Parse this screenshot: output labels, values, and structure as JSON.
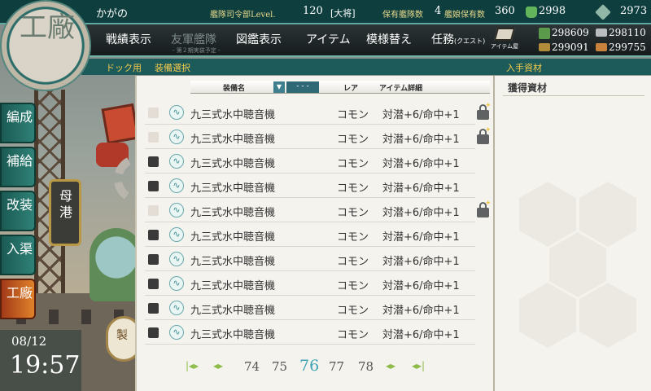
{
  "header": {
    "admiral_name": "かがの",
    "hq_level_label": "艦隊司令部Level.",
    "hq_level": "120",
    "rank": "[大将]",
    "fleet_count_label": "保有艦隊数",
    "fleet_count": "4",
    "ship_count_label": "艦娘保有数",
    "ship_count": "360",
    "bucket_count": "2998",
    "devmat_count": "2973"
  },
  "emblem_text": "工廠",
  "menu": {
    "items": [
      {
        "label": "戦績表示"
      },
      {
        "label": "友軍艦隊",
        "sub": "- 第２期実装予定 -",
        "disabled": true
      },
      {
        "label": "図鑑表示"
      },
      {
        "label": "アイテム"
      },
      {
        "label": "模様替え"
      },
      {
        "label": "任務",
        "small": "(クエスト)"
      }
    ],
    "shop_label": "アイテム屋"
  },
  "resources": {
    "fuel": "298609",
    "steel": "298110",
    "ammo": "299091",
    "bauxite": "299755"
  },
  "breadcrumb": {
    "dock": "ドック用",
    "title": "装備選択",
    "obtained": "入手資材"
  },
  "side_nav": [
    {
      "label": "編成",
      "icon": "fleet-icon"
    },
    {
      "label": "補給",
      "icon": "supply-icon"
    },
    {
      "label": "改装",
      "icon": "remodel-icon"
    },
    {
      "label": "入渠",
      "icon": "repair-icon"
    },
    {
      "label": "工廠",
      "icon": "arsenal-icon"
    }
  ],
  "mode_switch": "母港",
  "craft_button": "製",
  "clock": {
    "date": "08/12",
    "time": "19:57"
  },
  "list": {
    "col_name": "装備名",
    "sort_label": "- - -",
    "col_rarity": "レア",
    "col_detail": "アイテム詳細",
    "rows": [
      {
        "name": "九三式水中聴音機",
        "rarity": "コモン",
        "detail": "対潜+6/命中+1",
        "checked": false,
        "locked": true
      },
      {
        "name": "九三式水中聴音機",
        "rarity": "コモン",
        "detail": "対潜+6/命中+1",
        "checked": false,
        "locked": true
      },
      {
        "name": "九三式水中聴音機",
        "rarity": "コモン",
        "detail": "対潜+6/命中+1",
        "checked": true,
        "locked": false
      },
      {
        "name": "九三式水中聴音機",
        "rarity": "コモン",
        "detail": "対潜+6/命中+1",
        "checked": true,
        "locked": false
      },
      {
        "name": "九三式水中聴音機",
        "rarity": "コモン",
        "detail": "対潜+6/命中+1",
        "checked": false,
        "locked": true
      },
      {
        "name": "九三式水中聴音機",
        "rarity": "コモン",
        "detail": "対潜+6/命中+1",
        "checked": true,
        "locked": false
      },
      {
        "name": "九三式水中聴音機",
        "rarity": "コモン",
        "detail": "対潜+6/命中+1",
        "checked": true,
        "locked": false
      },
      {
        "name": "九三式水中聴音機",
        "rarity": "コモン",
        "detail": "対潜+6/命中+1",
        "checked": true,
        "locked": false
      },
      {
        "name": "九三式水中聴音機",
        "rarity": "コモン",
        "detail": "対潜+6/命中+1",
        "checked": true,
        "locked": false
      },
      {
        "name": "九三式水中聴音機",
        "rarity": "コモン",
        "detail": "対潜+6/命中+1",
        "checked": true,
        "locked": false
      }
    ]
  },
  "pager": {
    "first": "|◂▸",
    "prev": "◂▸",
    "pages": [
      "74",
      "75",
      "76",
      "77",
      "78"
    ],
    "current": "76",
    "next": "◂▸",
    "last": "◂▸|"
  },
  "obtained_panel": {
    "title": "獲得資材"
  },
  "colors": {
    "accent": "#3fa3b4",
    "topbar": "#0f3e3e",
    "crumb_text": "#f5cc4e"
  }
}
